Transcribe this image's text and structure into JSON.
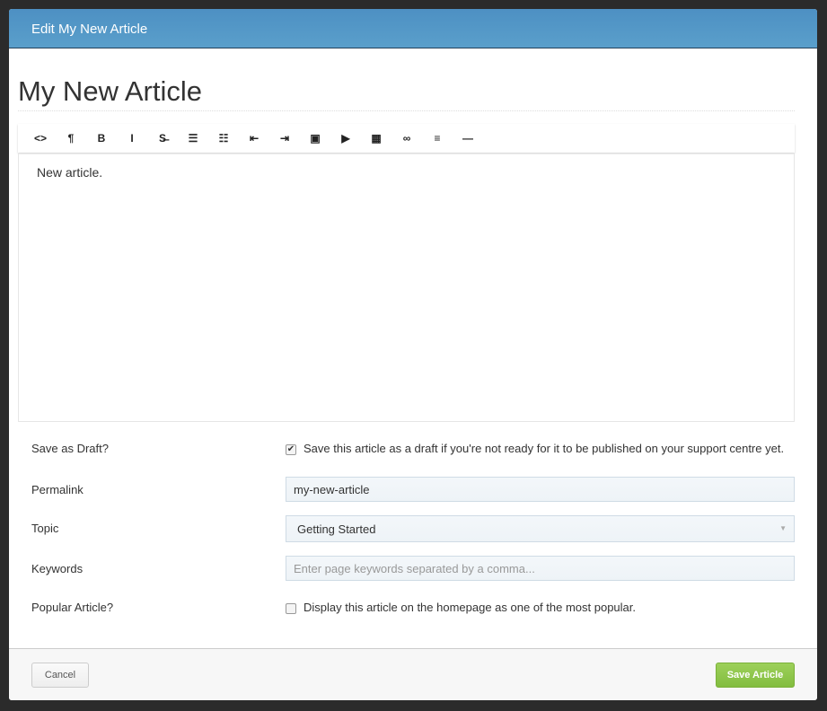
{
  "modal": {
    "title": "Edit My New Article"
  },
  "article": {
    "title": "My New Article",
    "body": "New article."
  },
  "toolbar": [
    {
      "icon": "html-code-icon",
      "glyph": "<>"
    },
    {
      "icon": "paragraph-icon",
      "glyph": "¶"
    },
    {
      "icon": "bold-icon",
      "glyph": "B"
    },
    {
      "icon": "italic-icon",
      "glyph": "I"
    },
    {
      "icon": "strikethrough-icon",
      "glyph": "S̶"
    },
    {
      "icon": "unordered-list-icon",
      "glyph": "☰"
    },
    {
      "icon": "ordered-list-icon",
      "glyph": "☷"
    },
    {
      "icon": "outdent-icon",
      "glyph": "⇤"
    },
    {
      "icon": "indent-icon",
      "glyph": "⇥"
    },
    {
      "icon": "image-icon",
      "glyph": "▣"
    },
    {
      "icon": "video-icon",
      "glyph": "▶"
    },
    {
      "icon": "table-icon",
      "glyph": "▦"
    },
    {
      "icon": "link-icon",
      "glyph": "∞"
    },
    {
      "icon": "align-left-icon",
      "glyph": "≡"
    },
    {
      "icon": "horizontal-rule-icon",
      "glyph": "—"
    }
  ],
  "form": {
    "draft": {
      "label": "Save as Draft?",
      "checked": true,
      "text": "Save this article as a draft if you're not ready for it to be published on your support centre yet."
    },
    "permalink": {
      "label": "Permalink",
      "value": "my-new-article"
    },
    "topic": {
      "label": "Topic",
      "value": "Getting Started"
    },
    "keywords": {
      "label": "Keywords",
      "placeholder": "Enter page keywords separated by a comma..."
    },
    "popular": {
      "label": "Popular Article?",
      "checked": false,
      "text": "Display this article on the homepage as one of the most popular."
    }
  },
  "footer": {
    "cancel": "Cancel",
    "save": "Save Article"
  },
  "colors": {
    "header": "#5299c8",
    "save": "#8dc549"
  }
}
